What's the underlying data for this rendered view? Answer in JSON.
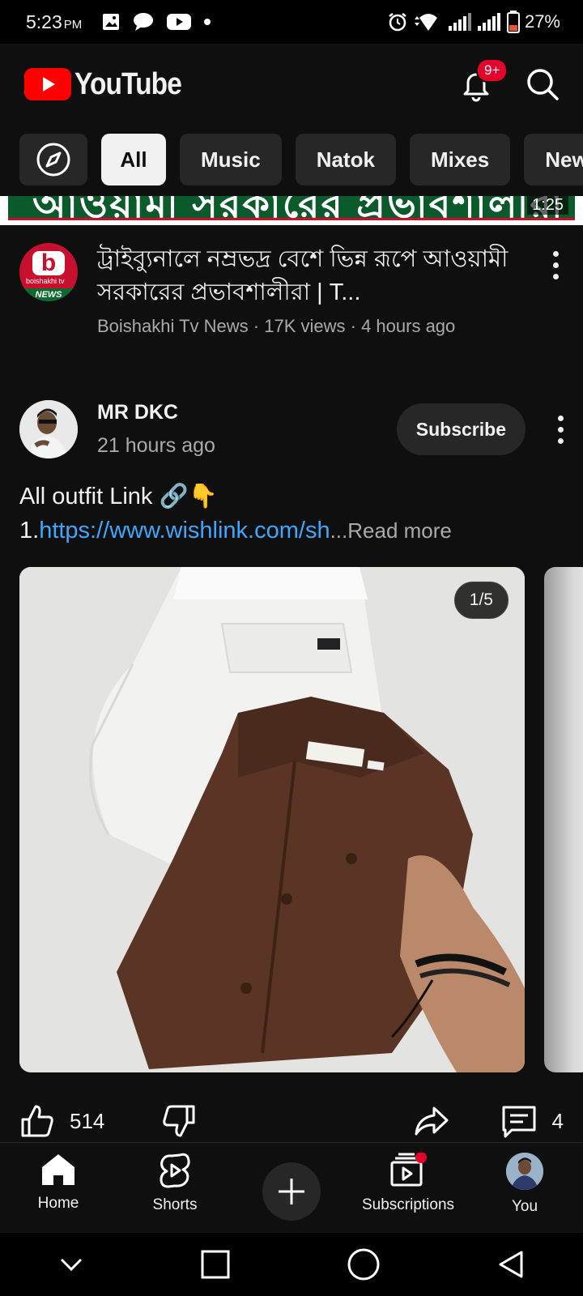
{
  "status_bar": {
    "time": "5:23",
    "ampm": "PM",
    "battery": "27%"
  },
  "header": {
    "app_name": "YouTube",
    "notification_badge": "9+",
    "brand_color": "#ff0000"
  },
  "chips": [
    "All",
    "Music",
    "Natok",
    "Mixes",
    "New"
  ],
  "banner": {
    "overlay_text": "আওয়ামী সরকারের প্রভাবশালীরা",
    "duration": "1:25"
  },
  "video": {
    "channel_avatar_text": "boishakhi tv",
    "channel_avatar_news": "NEWS",
    "title": "ট্রাইব্যুনালে নম্রভদ্র বেশে ভিন্ন রূপে আওয়ামী সরকারের প্রভাবশালীরা | T...",
    "channel": "Boishakhi Tv News",
    "views": "17K views",
    "age": "4 hours ago"
  },
  "post": {
    "author": "MR DKC",
    "time": "21 hours ago",
    "subscribe_label": "Subscribe",
    "text_line1": "All outfit Link 🔗👇",
    "text_prefix": "1.",
    "link": "https://www.wishlink.com/sh",
    "ellipsis": "...",
    "read_more": "Read more",
    "image_counter": "1/5",
    "likes": "514",
    "comments": "4"
  },
  "bottom_nav": {
    "home": "Home",
    "shorts": "Shorts",
    "subscriptions": "Subscriptions",
    "you": "You"
  }
}
